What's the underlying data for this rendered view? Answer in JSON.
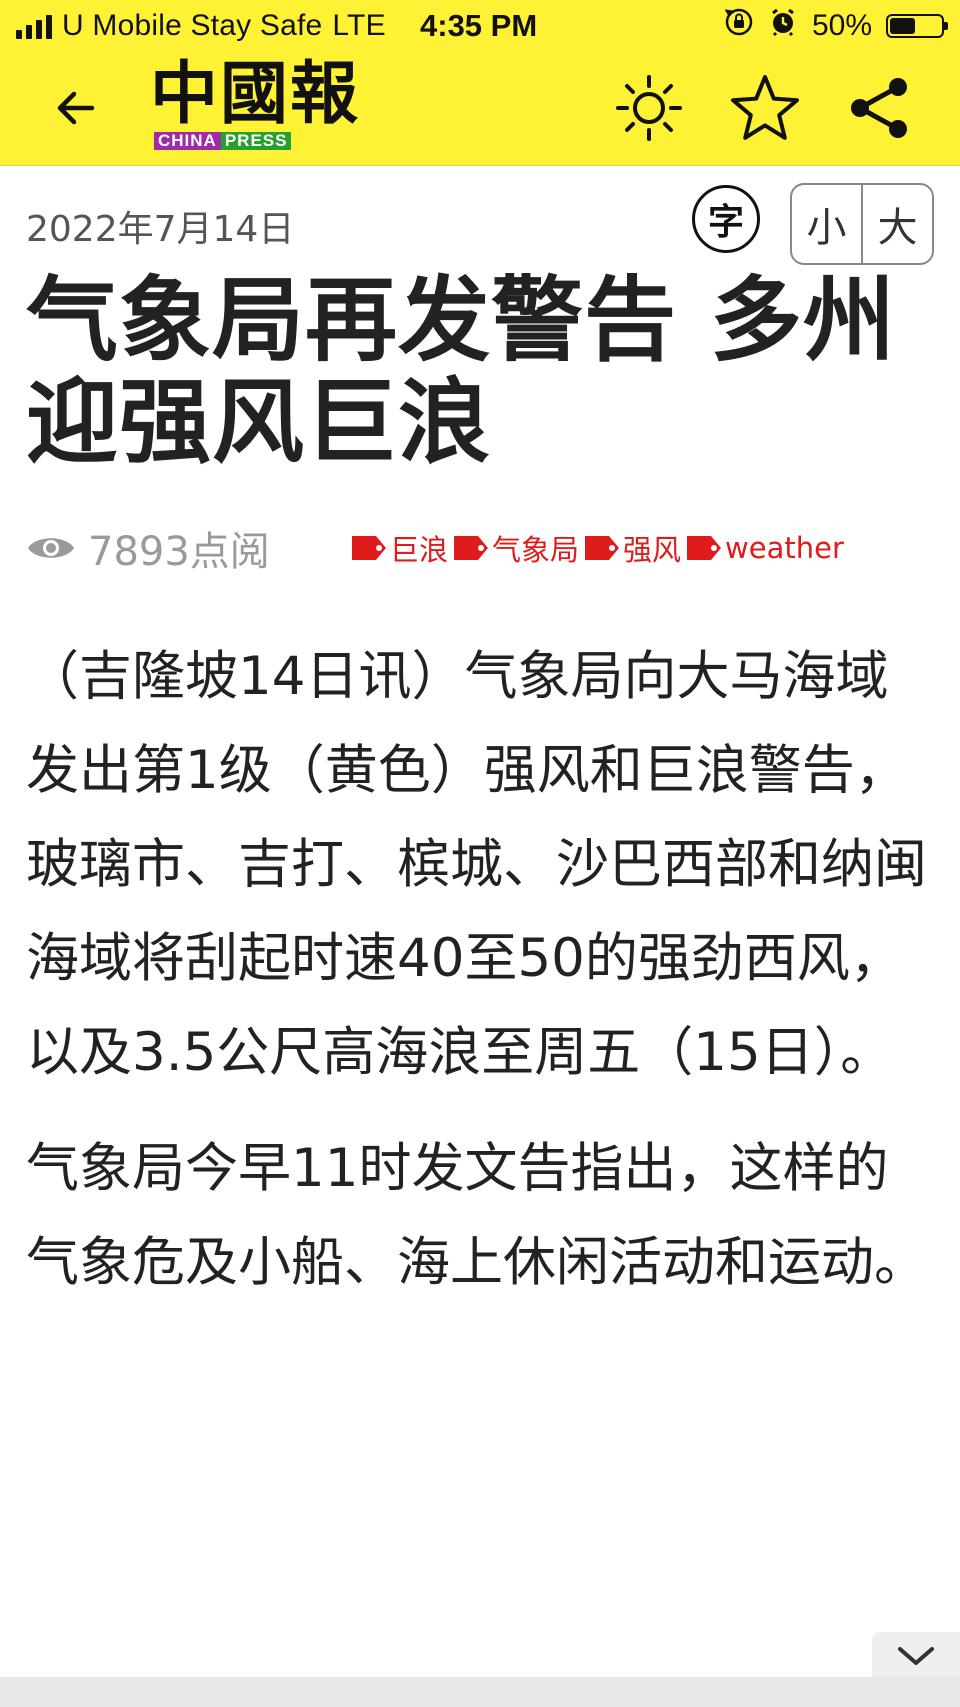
{
  "status_bar": {
    "carrier": "U Mobile Stay Safe",
    "network": "LTE",
    "time": "4:35 PM",
    "battery_percent": "50%",
    "battery_level": 0.5,
    "signal_bars": 4
  },
  "header": {
    "logo_cn": "中國報",
    "logo_en_china": "CHINA",
    "logo_en_press": "PRESS",
    "accent_color": "#fff133",
    "icons": [
      "back-arrow-icon",
      "brightness-icon",
      "star-icon",
      "share-icon"
    ]
  },
  "article": {
    "date": "2022年7月14日",
    "font_badge": "字",
    "font_small": "小",
    "font_large": "大",
    "title": "气象局再发警告 多州迎强风巨浪",
    "views": "7893点阅",
    "tags": [
      "巨浪",
      "气象局",
      "强风",
      "weather"
    ],
    "tag_color": "#e01b1b",
    "paragraphs": [
      "（吉隆坡14日讯）气象局向大马海域发出第1级（黄色）强风和巨浪警告，玻璃市、吉打、槟城、沙巴西部和纳闽海域将刮起时速40至50的强劲西风，以及3.5公尺高海浪至周五（15日）。",
      "气象局今早11时发文告指出，这样的气象危及小船、海上休闲活动和运动。"
    ]
  }
}
